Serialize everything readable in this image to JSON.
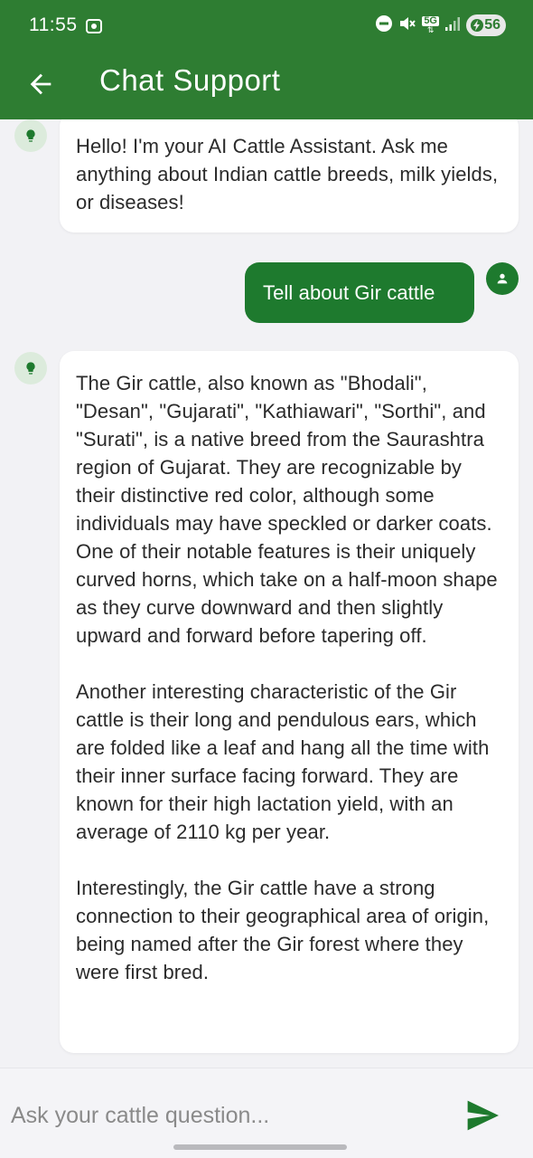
{
  "status_bar": {
    "time": "11:55",
    "network": "5G",
    "battery": "56",
    "icons": [
      "screen-record-icon",
      "do-not-disturb-icon",
      "mute-vibrate-icon",
      "5g-icon",
      "signal-icon",
      "battery-charging-icon"
    ]
  },
  "app_bar": {
    "title": "Chat Support",
    "back_icon": "arrow-left-icon"
  },
  "messages": [
    {
      "sender": "bot",
      "icon": "lightbulb-icon",
      "paragraphs": [
        "Hello! I'm your AI Cattle Assistant. Ask me anything about Indian cattle breeds, milk yields, or diseases!"
      ]
    },
    {
      "sender": "user",
      "icon": "person-icon",
      "text": "Tell about Gir cattle"
    },
    {
      "sender": "bot",
      "icon": "lightbulb-icon",
      "paragraphs": [
        "The Gir cattle, also known as \"Bhodali\", \"Desan\", \"Gujarati\", \"Kathiawari\", \"Sorthi\", and \"Surati\", is a native breed from the Saurashtra region of Gujarat. They are recognizable by their distinctive red color, although some individuals may have speckled or darker coats. One of their notable features is their uniquely curved horns, which take on a half-moon shape as they curve downward and then slightly upward and forward before tapering off.",
        "Another interesting characteristic of the Gir cattle is their long and pendulous ears, which are folded like a leaf and hang all the time with their inner surface facing forward. They are known for their high lactation yield, with an average of 2110 kg per year.",
        "Interestingly, the Gir cattle have a strong connection to their geographical area of origin, being named after the Gir forest where they were first bred."
      ]
    }
  ],
  "input": {
    "placeholder": "Ask your cattle question...",
    "value": "",
    "send_icon": "send-icon"
  },
  "colors": {
    "primary": "#2e7d32",
    "user_bubble": "#1e7a2e",
    "bot_bubble": "#ffffff",
    "bot_avatar": "#dcebdc",
    "background": "#f2f2f5"
  }
}
